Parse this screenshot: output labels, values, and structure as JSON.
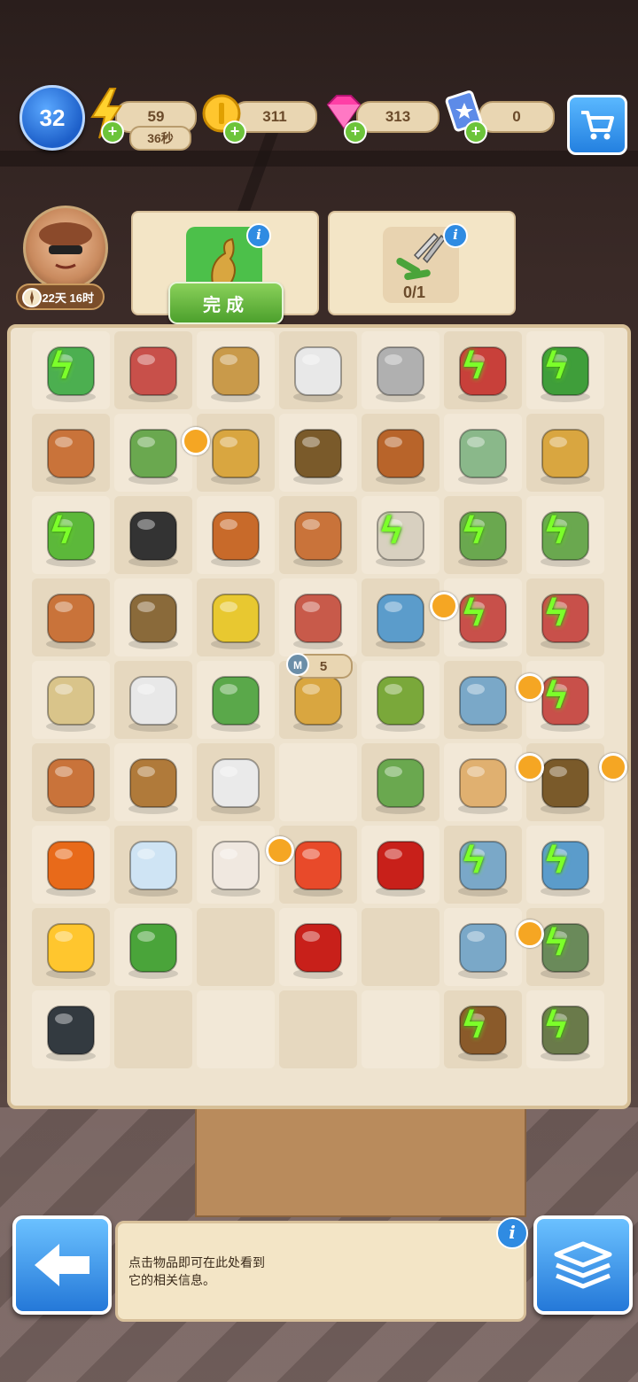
{
  "hud": {
    "level": "32",
    "energy": "59",
    "energy_timer": "36秒",
    "coins": "311",
    "gems": "313",
    "cards": "0"
  },
  "character": {
    "event_timer": "22天 16时"
  },
  "orders": {
    "complete_label": "完成",
    "second_order_progress": "0/1"
  },
  "board": {
    "item_count_badge": "5",
    "items": [
      {
        "r": 0,
        "c": 0,
        "name": "plant-icon",
        "bolt": true
      },
      {
        "r": 0,
        "c": 1,
        "name": "toy-car-icon"
      },
      {
        "r": 0,
        "c": 2,
        "name": "bread-icon"
      },
      {
        "r": 0,
        "c": 3,
        "name": "wheel-icon"
      },
      {
        "r": 0,
        "c": 4,
        "name": "toolbox-open-icon"
      },
      {
        "r": 0,
        "c": 5,
        "name": "red-toolbox-icon",
        "bolt": true
      },
      {
        "r": 0,
        "c": 6,
        "name": "shrub-icon",
        "bolt": true
      },
      {
        "r": 1,
        "c": 0,
        "name": "broken-pot-icon"
      },
      {
        "r": 1,
        "c": 1,
        "name": "flower-pot-icon"
      },
      {
        "r": 1,
        "c": 2,
        "name": "handle-icon"
      },
      {
        "r": 1,
        "c": 3,
        "name": "sprout-pot-icon"
      },
      {
        "r": 1,
        "c": 4,
        "name": "wood-tray-icon"
      },
      {
        "r": 1,
        "c": 5,
        "name": "green-vase-icon"
      },
      {
        "r": 1,
        "c": 6,
        "name": "ornate-vase-icon"
      },
      {
        "r": 2,
        "c": 0,
        "name": "sapling-icon",
        "bolt": true
      },
      {
        "r": 2,
        "c": 1,
        "name": "tire-stack-icon"
      },
      {
        "r": 2,
        "c": 2,
        "name": "paint-tray-icon"
      },
      {
        "r": 2,
        "c": 3,
        "name": "broken-pot-icon"
      },
      {
        "r": 2,
        "c": 4,
        "name": "stone-pot-icon",
        "bolt": true
      },
      {
        "r": 2,
        "c": 5,
        "name": "pink-flowers-icon",
        "bolt": true
      },
      {
        "r": 2,
        "c": 6,
        "name": "pink-flowers-icon",
        "bolt": true
      },
      {
        "r": 3,
        "c": 0,
        "name": "clay-pot-icon"
      },
      {
        "r": 3,
        "c": 1,
        "name": "seedling-pot-icon"
      },
      {
        "r": 3,
        "c": 2,
        "name": "paint-roller-icon"
      },
      {
        "r": 3,
        "c": 3,
        "name": "fireplace-icon"
      },
      {
        "r": 3,
        "c": 4,
        "name": "blue-vase-icon"
      },
      {
        "r": 3,
        "c": 5,
        "name": "red-car-icon",
        "bolt": true
      },
      {
        "r": 3,
        "c": 6,
        "name": "red-car-icon",
        "bolt": true
      },
      {
        "r": 4,
        "c": 0,
        "name": "sack-icon"
      },
      {
        "r": 4,
        "c": 1,
        "name": "wheels-icon"
      },
      {
        "r": 4,
        "c": 2,
        "name": "saw-icon"
      },
      {
        "r": 4,
        "c": 3,
        "name": "brass-handle-icon"
      },
      {
        "r": 4,
        "c": 4,
        "name": "green-pot-icon"
      },
      {
        "r": 4,
        "c": 5,
        "name": "drawer-cabinet-icon"
      },
      {
        "r": 4,
        "c": 6,
        "name": "red-car-icon",
        "bolt": true
      },
      {
        "r": 5,
        "c": 0,
        "name": "broken-pot-shard-icon"
      },
      {
        "r": 5,
        "c": 1,
        "name": "wooden-chest-icon"
      },
      {
        "r": 5,
        "c": 2,
        "name": "white-vase-icon"
      },
      {
        "r": 5,
        "c": 3,
        "name": "empty-cell-icon"
      },
      {
        "r": 5,
        "c": 4,
        "name": "flowering-plant-icon"
      },
      {
        "r": 5,
        "c": 5,
        "name": "dresser-icon"
      },
      {
        "r": 5,
        "c": 6,
        "name": "blue-pot-sprout-icon"
      },
      {
        "r": 6,
        "c": 0,
        "name": "screwdriver-icon"
      },
      {
        "r": 6,
        "c": 1,
        "name": "glass-vase-icon"
      },
      {
        "r": 6,
        "c": 2,
        "name": "painted-vase-icon"
      },
      {
        "r": 6,
        "c": 3,
        "name": "tulip-pot-icon"
      },
      {
        "r": 6,
        "c": 4,
        "name": "roses-icon"
      },
      {
        "r": 6,
        "c": 5,
        "name": "glass-cabinet-icon",
        "bolt": true
      },
      {
        "r": 6,
        "c": 6,
        "name": "blue-bowl-icon",
        "bolt": true
      },
      {
        "r": 7,
        "c": 0,
        "name": "gold-coins-icon"
      },
      {
        "r": 7,
        "c": 1,
        "name": "pliers-icon"
      },
      {
        "r": 7,
        "c": 2,
        "name": "empty-cell-icon"
      },
      {
        "r": 7,
        "c": 3,
        "name": "rose-icon"
      },
      {
        "r": 7,
        "c": 4,
        "name": "empty-cell-icon"
      },
      {
        "r": 7,
        "c": 5,
        "name": "cabinet-open-icon"
      },
      {
        "r": 7,
        "c": 6,
        "name": "tool-box-icon",
        "bolt": true
      },
      {
        "r": 8,
        "c": 0,
        "name": "vest-icon"
      },
      {
        "r": 8,
        "c": 1,
        "name": "empty-cell-icon"
      },
      {
        "r": 8,
        "c": 2,
        "name": "empty-cell-icon"
      },
      {
        "r": 8,
        "c": 3,
        "name": "empty-cell-icon"
      },
      {
        "r": 8,
        "c": 4,
        "name": "empty-cell-icon"
      },
      {
        "r": 8,
        "c": 5,
        "name": "tool-bucket-icon",
        "bolt": true
      },
      {
        "r": 8,
        "c": 6,
        "name": "garden-cart-icon",
        "bolt": true
      }
    ]
  },
  "info_panel": {
    "text": "点击物品即可在此处看到\n它的相关信息。"
  },
  "colors": {
    "accent_blue": "#2f8be2",
    "complete_green": "#4ca02c",
    "energy_bolt": "#7cff2a"
  }
}
